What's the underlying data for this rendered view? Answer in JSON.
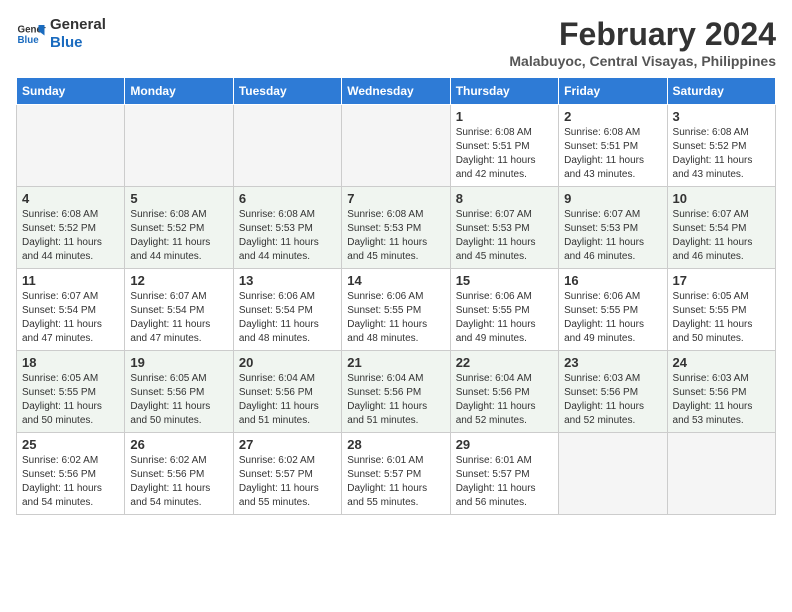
{
  "logo": {
    "line1": "General",
    "line2": "Blue"
  },
  "title": "February 2024",
  "subtitle": "Malabuyoc, Central Visayas, Philippines",
  "headers": [
    "Sunday",
    "Monday",
    "Tuesday",
    "Wednesday",
    "Thursday",
    "Friday",
    "Saturday"
  ],
  "weeks": [
    [
      {
        "day": "",
        "info": ""
      },
      {
        "day": "",
        "info": ""
      },
      {
        "day": "",
        "info": ""
      },
      {
        "day": "",
        "info": ""
      },
      {
        "day": "1",
        "info": "Sunrise: 6:08 AM\nSunset: 5:51 PM\nDaylight: 11 hours and 42 minutes."
      },
      {
        "day": "2",
        "info": "Sunrise: 6:08 AM\nSunset: 5:51 PM\nDaylight: 11 hours and 43 minutes."
      },
      {
        "day": "3",
        "info": "Sunrise: 6:08 AM\nSunset: 5:52 PM\nDaylight: 11 hours and 43 minutes."
      }
    ],
    [
      {
        "day": "4",
        "info": "Sunrise: 6:08 AM\nSunset: 5:52 PM\nDaylight: 11 hours and 44 minutes."
      },
      {
        "day": "5",
        "info": "Sunrise: 6:08 AM\nSunset: 5:52 PM\nDaylight: 11 hours and 44 minutes."
      },
      {
        "day": "6",
        "info": "Sunrise: 6:08 AM\nSunset: 5:53 PM\nDaylight: 11 hours and 44 minutes."
      },
      {
        "day": "7",
        "info": "Sunrise: 6:08 AM\nSunset: 5:53 PM\nDaylight: 11 hours and 45 minutes."
      },
      {
        "day": "8",
        "info": "Sunrise: 6:07 AM\nSunset: 5:53 PM\nDaylight: 11 hours and 45 minutes."
      },
      {
        "day": "9",
        "info": "Sunrise: 6:07 AM\nSunset: 5:53 PM\nDaylight: 11 hours and 46 minutes."
      },
      {
        "day": "10",
        "info": "Sunrise: 6:07 AM\nSunset: 5:54 PM\nDaylight: 11 hours and 46 minutes."
      }
    ],
    [
      {
        "day": "11",
        "info": "Sunrise: 6:07 AM\nSunset: 5:54 PM\nDaylight: 11 hours and 47 minutes."
      },
      {
        "day": "12",
        "info": "Sunrise: 6:07 AM\nSunset: 5:54 PM\nDaylight: 11 hours and 47 minutes."
      },
      {
        "day": "13",
        "info": "Sunrise: 6:06 AM\nSunset: 5:54 PM\nDaylight: 11 hours and 48 minutes."
      },
      {
        "day": "14",
        "info": "Sunrise: 6:06 AM\nSunset: 5:55 PM\nDaylight: 11 hours and 48 minutes."
      },
      {
        "day": "15",
        "info": "Sunrise: 6:06 AM\nSunset: 5:55 PM\nDaylight: 11 hours and 49 minutes."
      },
      {
        "day": "16",
        "info": "Sunrise: 6:06 AM\nSunset: 5:55 PM\nDaylight: 11 hours and 49 minutes."
      },
      {
        "day": "17",
        "info": "Sunrise: 6:05 AM\nSunset: 5:55 PM\nDaylight: 11 hours and 50 minutes."
      }
    ],
    [
      {
        "day": "18",
        "info": "Sunrise: 6:05 AM\nSunset: 5:55 PM\nDaylight: 11 hours and 50 minutes."
      },
      {
        "day": "19",
        "info": "Sunrise: 6:05 AM\nSunset: 5:56 PM\nDaylight: 11 hours and 50 minutes."
      },
      {
        "day": "20",
        "info": "Sunrise: 6:04 AM\nSunset: 5:56 PM\nDaylight: 11 hours and 51 minutes."
      },
      {
        "day": "21",
        "info": "Sunrise: 6:04 AM\nSunset: 5:56 PM\nDaylight: 11 hours and 51 minutes."
      },
      {
        "day": "22",
        "info": "Sunrise: 6:04 AM\nSunset: 5:56 PM\nDaylight: 11 hours and 52 minutes."
      },
      {
        "day": "23",
        "info": "Sunrise: 6:03 AM\nSunset: 5:56 PM\nDaylight: 11 hours and 52 minutes."
      },
      {
        "day": "24",
        "info": "Sunrise: 6:03 AM\nSunset: 5:56 PM\nDaylight: 11 hours and 53 minutes."
      }
    ],
    [
      {
        "day": "25",
        "info": "Sunrise: 6:02 AM\nSunset: 5:56 PM\nDaylight: 11 hours and 54 minutes."
      },
      {
        "day": "26",
        "info": "Sunrise: 6:02 AM\nSunset: 5:56 PM\nDaylight: 11 hours and 54 minutes."
      },
      {
        "day": "27",
        "info": "Sunrise: 6:02 AM\nSunset: 5:57 PM\nDaylight: 11 hours and 55 minutes."
      },
      {
        "day": "28",
        "info": "Sunrise: 6:01 AM\nSunset: 5:57 PM\nDaylight: 11 hours and 55 minutes."
      },
      {
        "day": "29",
        "info": "Sunrise: 6:01 AM\nSunset: 5:57 PM\nDaylight: 11 hours and 56 minutes."
      },
      {
        "day": "",
        "info": ""
      },
      {
        "day": "",
        "info": ""
      }
    ]
  ]
}
